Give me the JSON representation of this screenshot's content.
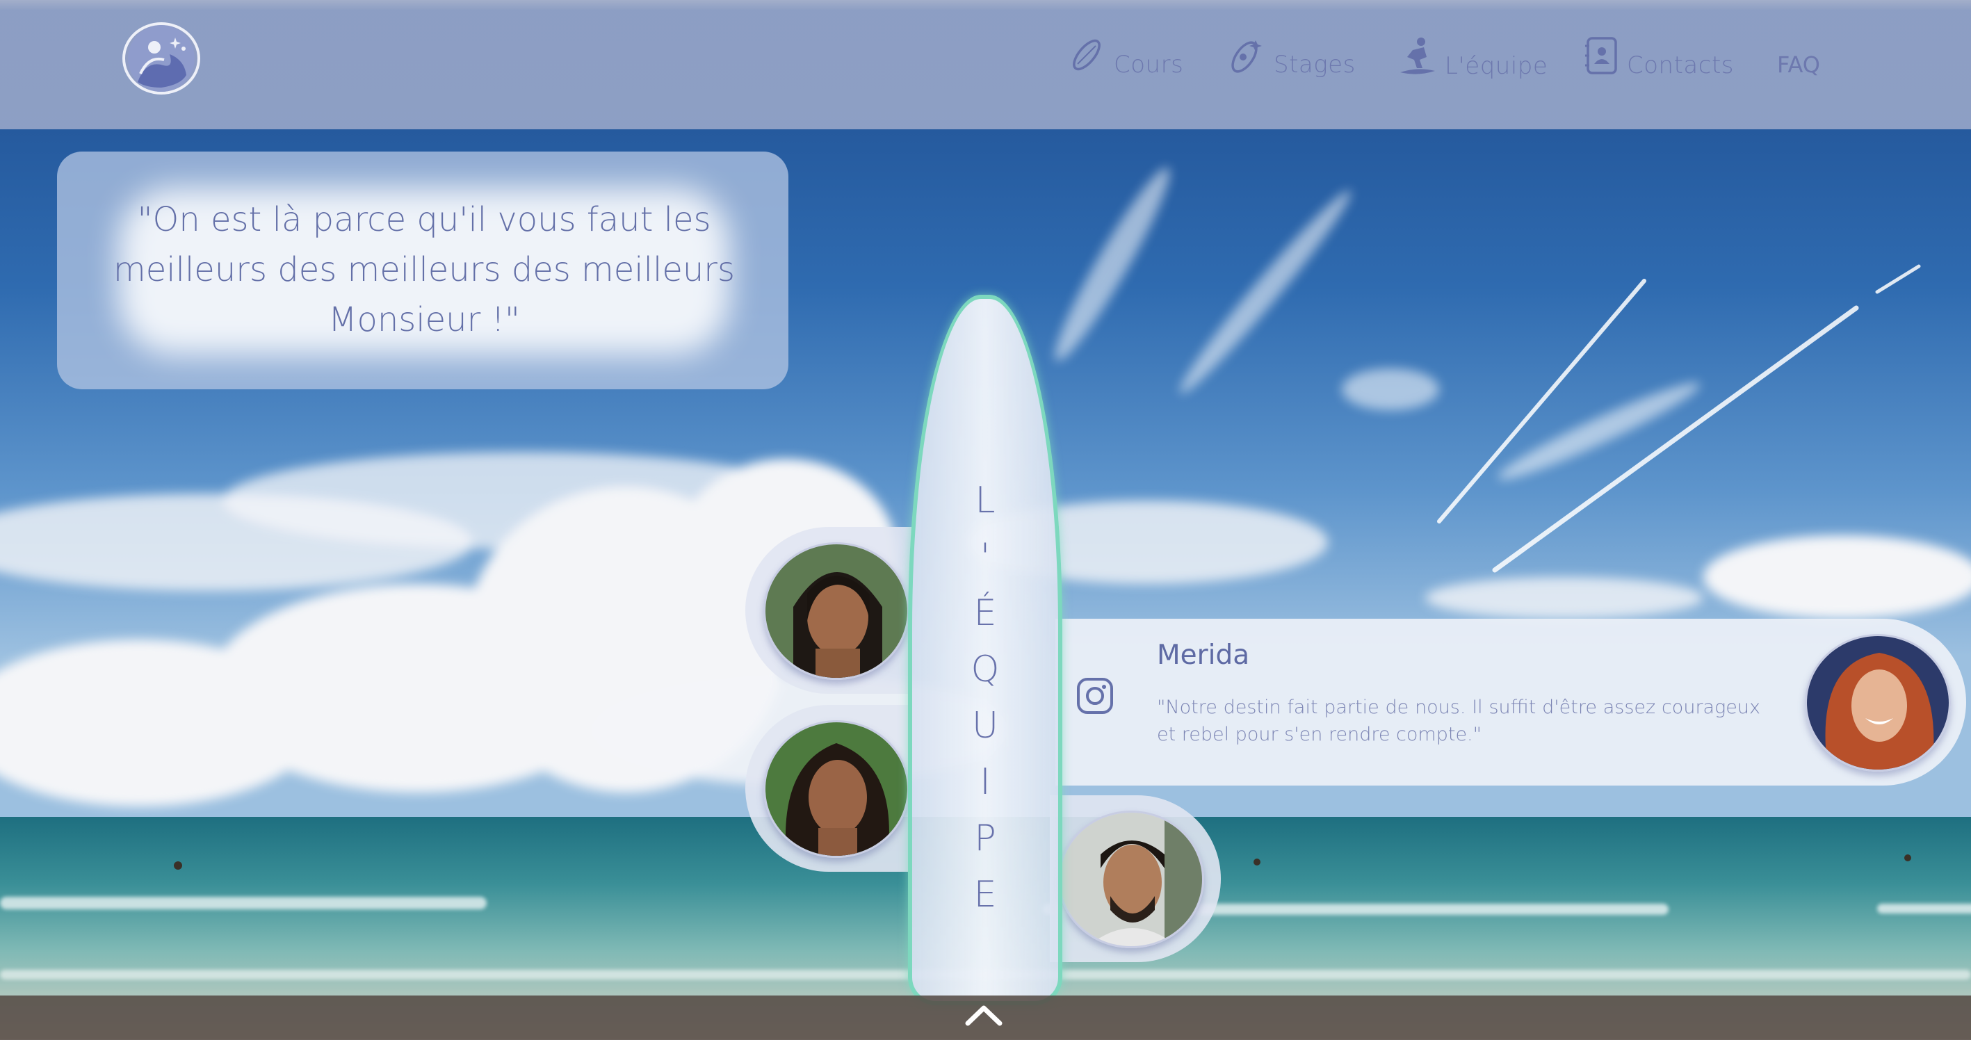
{
  "nav": {
    "items": [
      {
        "label": "Cours",
        "icon": "surfboard-icon"
      },
      {
        "label": "Stages",
        "icon": "surfboard-stickers-icon"
      },
      {
        "label": "L'équipe",
        "icon": "surfer-icon"
      },
      {
        "label": "Contacts",
        "icon": "contact-book-icon"
      }
    ],
    "faq": "FAQ"
  },
  "quote": {
    "line1": "\"On est là parce qu'il vous faut les",
    "line2": "meilleurs des meilleurs des meilleurs",
    "line3": "Monsieur !\""
  },
  "board_letters": [
    "L",
    "'",
    "É",
    "Q",
    "U",
    "I",
    "P",
    "E"
  ],
  "member": {
    "name": "Merida",
    "quote": "\"Notre destin fait partie de nous. Il suffit d'être assez courageux et rebel pour s'en rendre compte.\"",
    "social_icon": "instagram-icon"
  },
  "team_avatars": [
    "team-member-1",
    "team-member-2",
    "team-member-3",
    "team-member-merida"
  ],
  "colors": {
    "accent": "#6872ab",
    "board_outline": "#7dd8be",
    "header": "#96a5c8"
  }
}
